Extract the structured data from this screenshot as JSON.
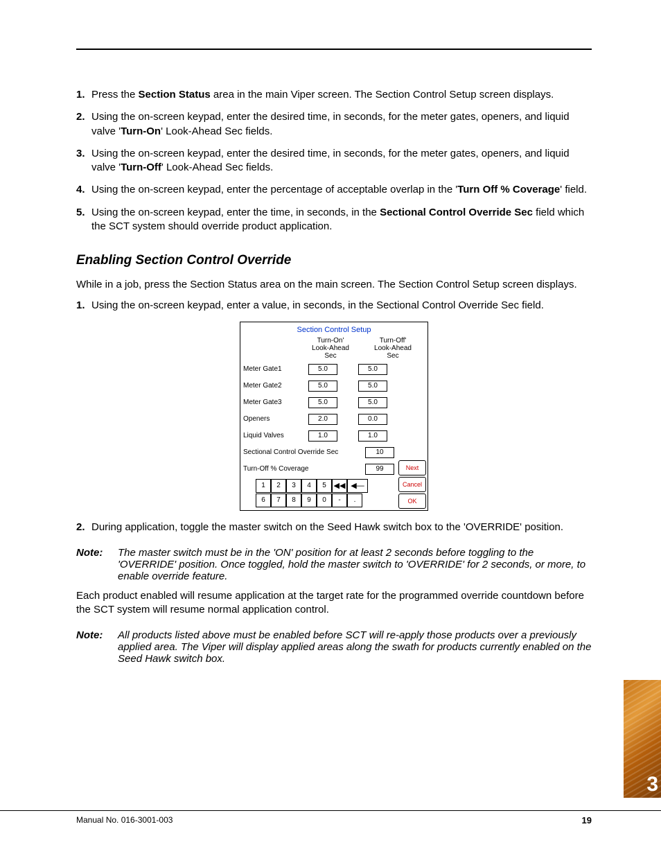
{
  "steps_section1": [
    {
      "num": "1.",
      "text_before": "Press the ",
      "bold": "Section Status",
      "text_after": " area in the main Viper screen. The Section Control Setup screen displays."
    },
    {
      "num": "2.",
      "text_before": "Using the on-screen keypad, enter the desired time, in seconds, for the meter gates, openers, and liquid valve '",
      "bold": "Turn-On",
      "text_after": "' Look-Ahead Sec fields."
    },
    {
      "num": "3.",
      "text_before": "Using the on-screen keypad, enter the desired time, in seconds, for the meter gates, openers, and liquid valve '",
      "bold": "Turn-Off",
      "text_after": "' Look-Ahead Sec fields."
    },
    {
      "num": "4.",
      "text_before": "Using the on-screen keypad, enter the percentage of acceptable overlap in the '",
      "bold": "Turn Off % Coverage",
      "text_after": "' field."
    },
    {
      "num": "5.",
      "text_before": "Using the on-screen keypad, enter the time, in seconds, in the ",
      "bold": "Sectional Control Override Sec",
      "text_after": " field which the SCT system should override product application."
    }
  ],
  "heading_override": "Enabling Section Control Override",
  "override_intro": "While in a job, press the Section Status area on the main screen. The Section Control Setup screen displays.",
  "steps_section2": [
    {
      "num": "1.",
      "text": "Using the on-screen keypad, enter a value, in seconds, in the Sectional Control Override Sec field."
    },
    {
      "num": "2.",
      "text": "During application, toggle the master switch on the Seed Hawk switch box to the 'OVERRIDE' position."
    }
  ],
  "note1_label": "Note:",
  "note1_text": "The master switch must be in the 'ON' position for at least 2 seconds before toggling to the 'OVERRIDE' position. Once toggled, hold the master switch to 'OVERRIDE' for 2 seconds, or more, to enable override feature.",
  "resume_text": "Each product enabled will resume application at the target rate for the programmed override countdown before the SCT system will resume normal application control.",
  "note2_label": "Note:",
  "note2_text": "All products listed above must be enabled before SCT will re-apply those products over a previously applied area. The Viper will display applied areas along the swath for products currently enabled on the Seed Hawk switch box.",
  "screenshot": {
    "title": "Section Control Setup",
    "col1": "Turn-On'\nLook-Ahead\nSec",
    "col2": "Turn-Off'\nLook-Ahead\nSec",
    "rows": [
      {
        "label": "Meter Gate1",
        "on": "5.0",
        "off": "5.0"
      },
      {
        "label": "Meter Gate2",
        "on": "5.0",
        "off": "5.0"
      },
      {
        "label": "Meter Gate3",
        "on": "5.0",
        "off": "5.0"
      },
      {
        "label": "Openers",
        "on": "2.0",
        "off": "0.0"
      },
      {
        "label": "Liquid Valves",
        "on": "1.0",
        "off": "1.0"
      }
    ],
    "override_label": "Sectional Control Override Sec",
    "override_val": "10",
    "coverage_label": "Turn-Off % Coverage",
    "coverage_val": "99",
    "btn_next": "Next",
    "btn_cancel": "Cancel",
    "btn_ok": "OK",
    "keys_row1": [
      "1",
      "2",
      "3",
      "4",
      "5"
    ],
    "keys_row2": [
      "6",
      "7",
      "8",
      "9",
      "0",
      "-",
      "."
    ]
  },
  "footer_left": "Manual No. 016-3001-003",
  "footer_right": "19",
  "chapter_tab": "3"
}
